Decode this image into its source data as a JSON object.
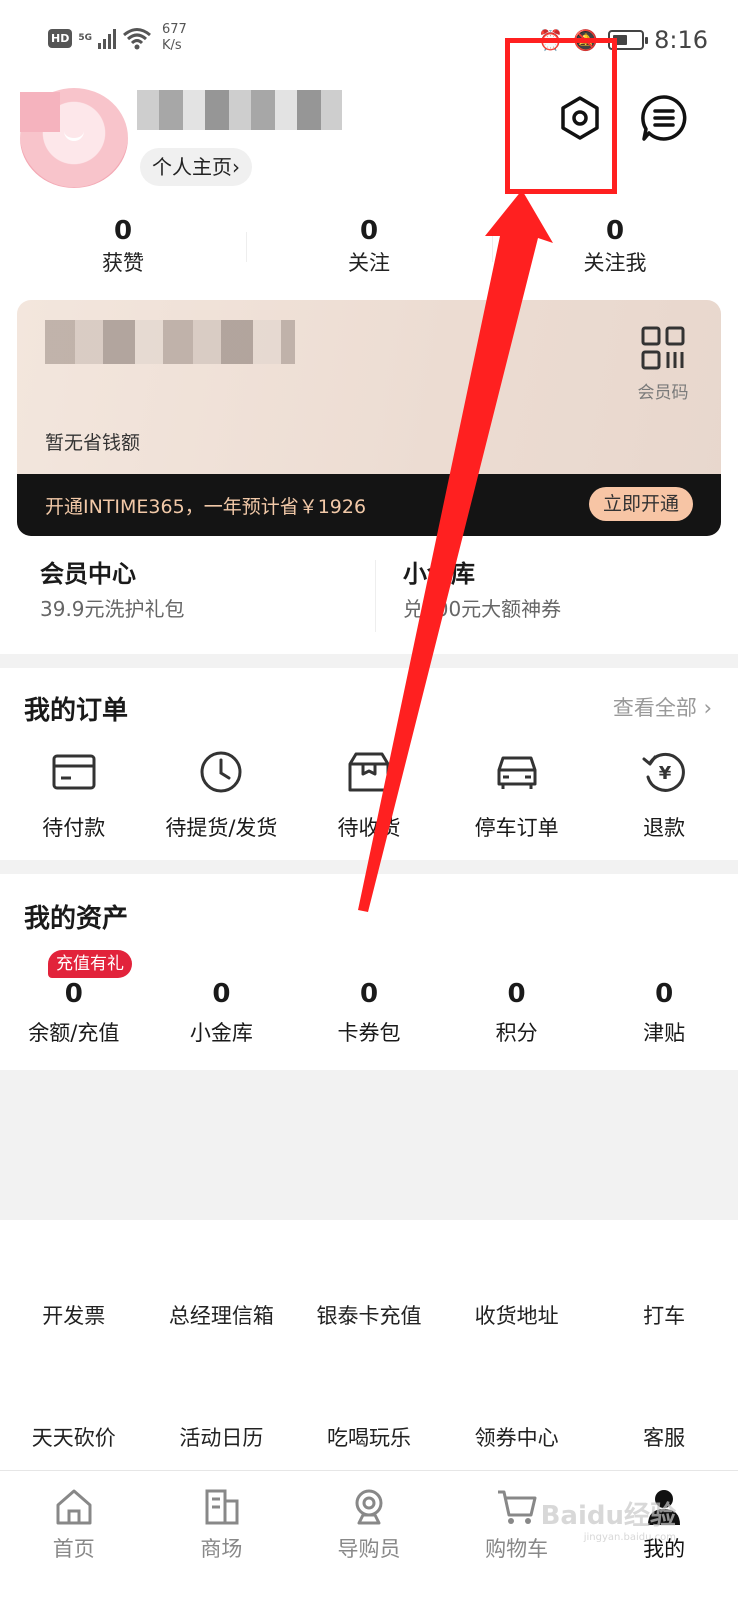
{
  "status_bar": {
    "hd": "HD",
    "signal": "5G",
    "speed_value": "677",
    "speed_unit": "K/s",
    "time": "8:16"
  },
  "profile": {
    "homepage_link": "个人主页"
  },
  "stats": [
    {
      "value": "0",
      "label": "获赞"
    },
    {
      "value": "0",
      "label": "关注"
    },
    {
      "value": "0",
      "label": "关注我"
    }
  ],
  "member_card": {
    "qr_label": "会员码",
    "savings_text": "暂无省钱额",
    "promo_text": "开通INTIME365，一年预计省￥1926",
    "open_button": "立即开通"
  },
  "member_center": [
    {
      "title": "会员中心",
      "subtitle": "39.9元洗护礼包"
    },
    {
      "title": "小金库",
      "subtitle": "兑300元大额神券"
    }
  ],
  "orders": {
    "title": "我的订单",
    "view_all": "查看全部",
    "items": [
      {
        "label": "待付款",
        "icon": "card-icon"
      },
      {
        "label": "待提货/发货",
        "icon": "clock-icon"
      },
      {
        "label": "待收货",
        "icon": "box-icon"
      },
      {
        "label": "停车订单",
        "icon": "car-icon"
      },
      {
        "label": "退款",
        "icon": "refund-icon"
      }
    ]
  },
  "assets": {
    "title": "我的资产",
    "badge": "充值有礼",
    "items": [
      {
        "value": "0",
        "label": "余额/充值"
      },
      {
        "value": "0",
        "label": "小金库"
      },
      {
        "value": "0",
        "label": "卡券包"
      },
      {
        "value": "0",
        "label": "积分"
      },
      {
        "value": "0",
        "label": "津贴"
      }
    ]
  },
  "services": {
    "row1": [
      "开发票",
      "总经理信箱",
      "银泰卡充值",
      "收货地址",
      "打车"
    ],
    "row2": [
      "天天砍价",
      "活动日历",
      "吃喝玩乐",
      "领券中心",
      "客服"
    ]
  },
  "bottom_nav": [
    {
      "label": "首页",
      "icon": "home-icon"
    },
    {
      "label": "商场",
      "icon": "mall-icon"
    },
    {
      "label": "导购员",
      "icon": "guide-icon"
    },
    {
      "label": "购物车",
      "icon": "cart-icon"
    },
    {
      "label": "我的",
      "icon": "user-icon"
    }
  ],
  "watermark": {
    "brand": "Baidu经验",
    "domain": "jingyan.baidu.com"
  },
  "colors": {
    "annotation_red": "#ff2020",
    "badge_red": "#e2233b",
    "promo_gold": "#f2c9a8",
    "button_peach": "#f7c5a5"
  }
}
